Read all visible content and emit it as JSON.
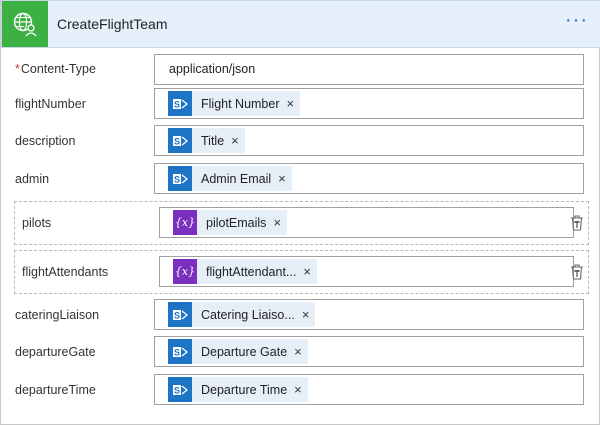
{
  "header": {
    "title": "CreateFlightTeam",
    "icon": "globe-user-icon",
    "more_label": "···",
    "color": "#3cb043"
  },
  "fields": {
    "content_type": {
      "label": "Content-Type",
      "required": true,
      "value": "application/json"
    },
    "flight_number": {
      "label": "flightNumber",
      "token": "Flight Number",
      "token_icon": "sharepoint-icon"
    },
    "description": {
      "label": "description",
      "token": "Title",
      "token_icon": "sharepoint-icon"
    },
    "admin": {
      "label": "admin",
      "token": "Admin Email",
      "token_icon": "sharepoint-icon"
    },
    "pilots": {
      "label": "pilots",
      "token": "pilotEmails",
      "token_icon": "variable-icon",
      "variable_glyph": "{x}"
    },
    "flight_attendants": {
      "label": "flightAttendants",
      "token": "flightAttendant...",
      "token_icon": "variable-icon",
      "variable_glyph": "{x}"
    },
    "catering_liaison": {
      "label": "cateringLiaison",
      "token": "Catering Liaiso...",
      "token_icon": "sharepoint-icon"
    },
    "departure_gate": {
      "label": "departureGate",
      "token": "Departure Gate",
      "token_icon": "sharepoint-icon"
    },
    "departure_time": {
      "label": "departureTime",
      "token": "Departure Time",
      "token_icon": "sharepoint-icon"
    }
  },
  "remove_glyph": "×",
  "colors": {
    "sharepoint": "#1e74c5",
    "variable": "#7a2fbf",
    "token_bg": "#e6eef7",
    "header_bg": "#e6f0fa"
  }
}
